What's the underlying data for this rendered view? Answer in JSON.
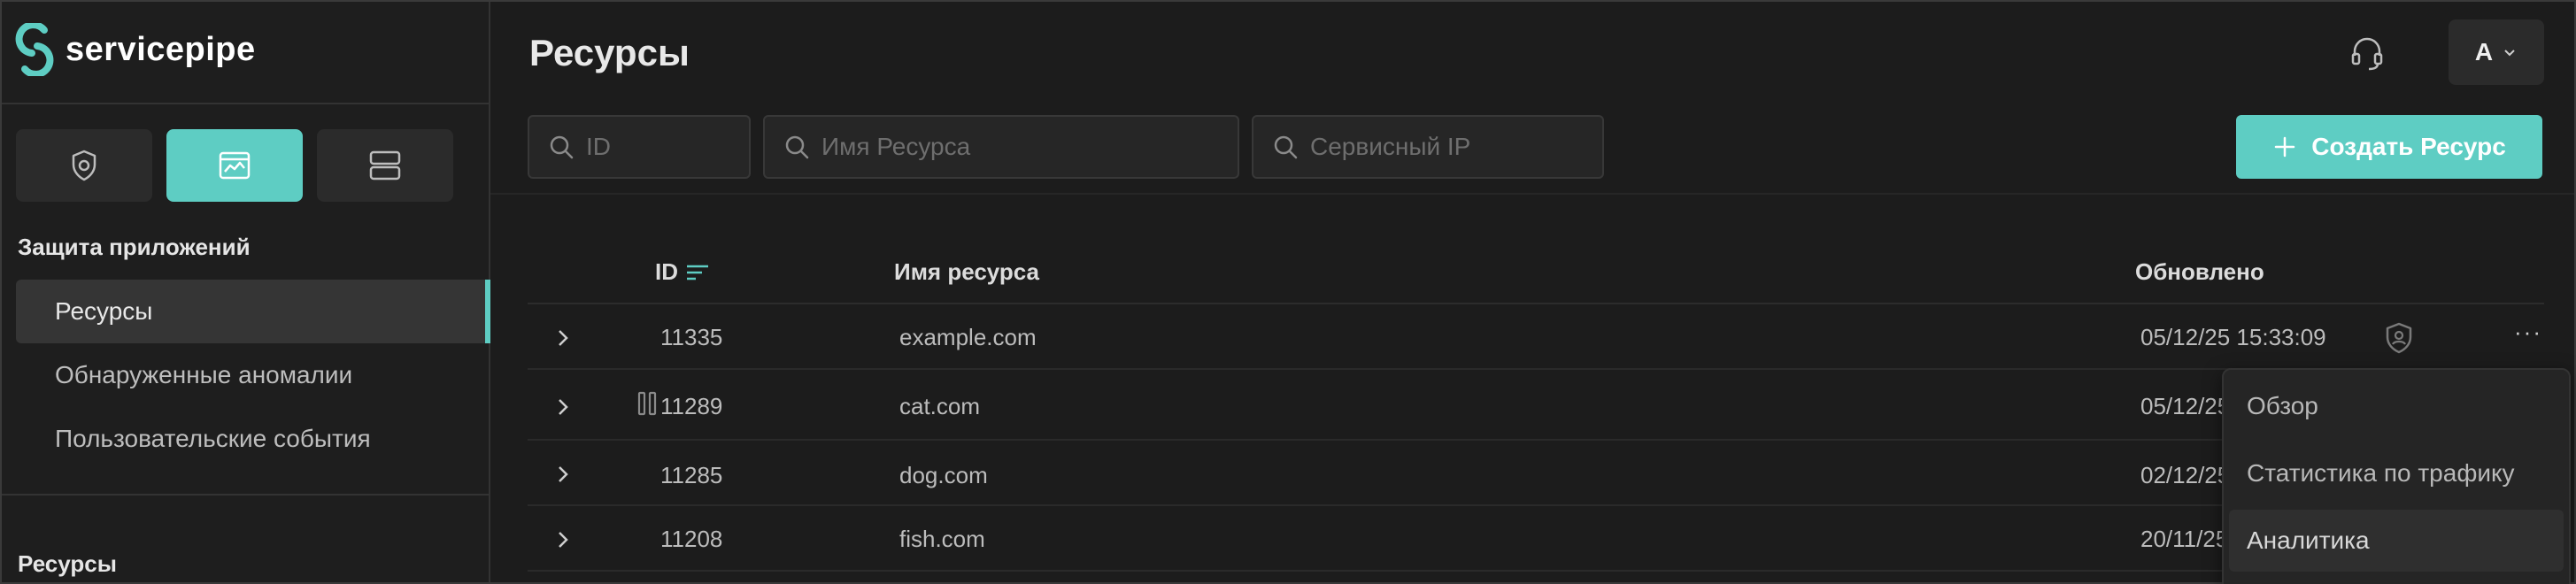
{
  "brand": {
    "name": "servicepipe",
    "accent": "#5ecdc3"
  },
  "sidebar": {
    "modules": [
      {
        "icon": "shield-cloud-icon",
        "active": false
      },
      {
        "icon": "web-app-icon",
        "active": true
      },
      {
        "icon": "servers-icon",
        "active": false
      }
    ],
    "section_title": "Защита приложений",
    "items": [
      {
        "label": "Ресурсы",
        "active": true
      },
      {
        "label": "Обнаруженные аномалии",
        "active": false
      },
      {
        "label": "Пользовательские события",
        "active": false
      }
    ],
    "section2_title": "Ресурсы"
  },
  "header": {
    "title": "Ресурсы",
    "user_initial": "A"
  },
  "filters": {
    "id_placeholder": "ID",
    "name_placeholder": "Имя Ресурса",
    "ip_placeholder": "Сервисный IP"
  },
  "create_button": "Создать Ресурс",
  "table": {
    "columns": {
      "id": "ID",
      "name": "Имя ресурса",
      "updated": "Обновлено"
    },
    "rows": [
      {
        "id": "11335",
        "name": "example.com",
        "updated": "05/12/25 15:33:09",
        "paused": false,
        "shield": true
      },
      {
        "id": "11289",
        "name": "cat.com",
        "updated": "05/12/25 16",
        "paused": true,
        "shield": false
      },
      {
        "id": "11285",
        "name": "dog.com",
        "updated": "02/12/25 15",
        "paused": false,
        "shield": false
      },
      {
        "id": "11208",
        "name": "fish.com",
        "updated": "20/11/25 05",
        "paused": false,
        "shield": false
      }
    ],
    "more_label": "···"
  },
  "row_menu": {
    "items": [
      "Обзор",
      "Статистика по трафику",
      "Аналитика"
    ],
    "hovered_index": 2
  }
}
